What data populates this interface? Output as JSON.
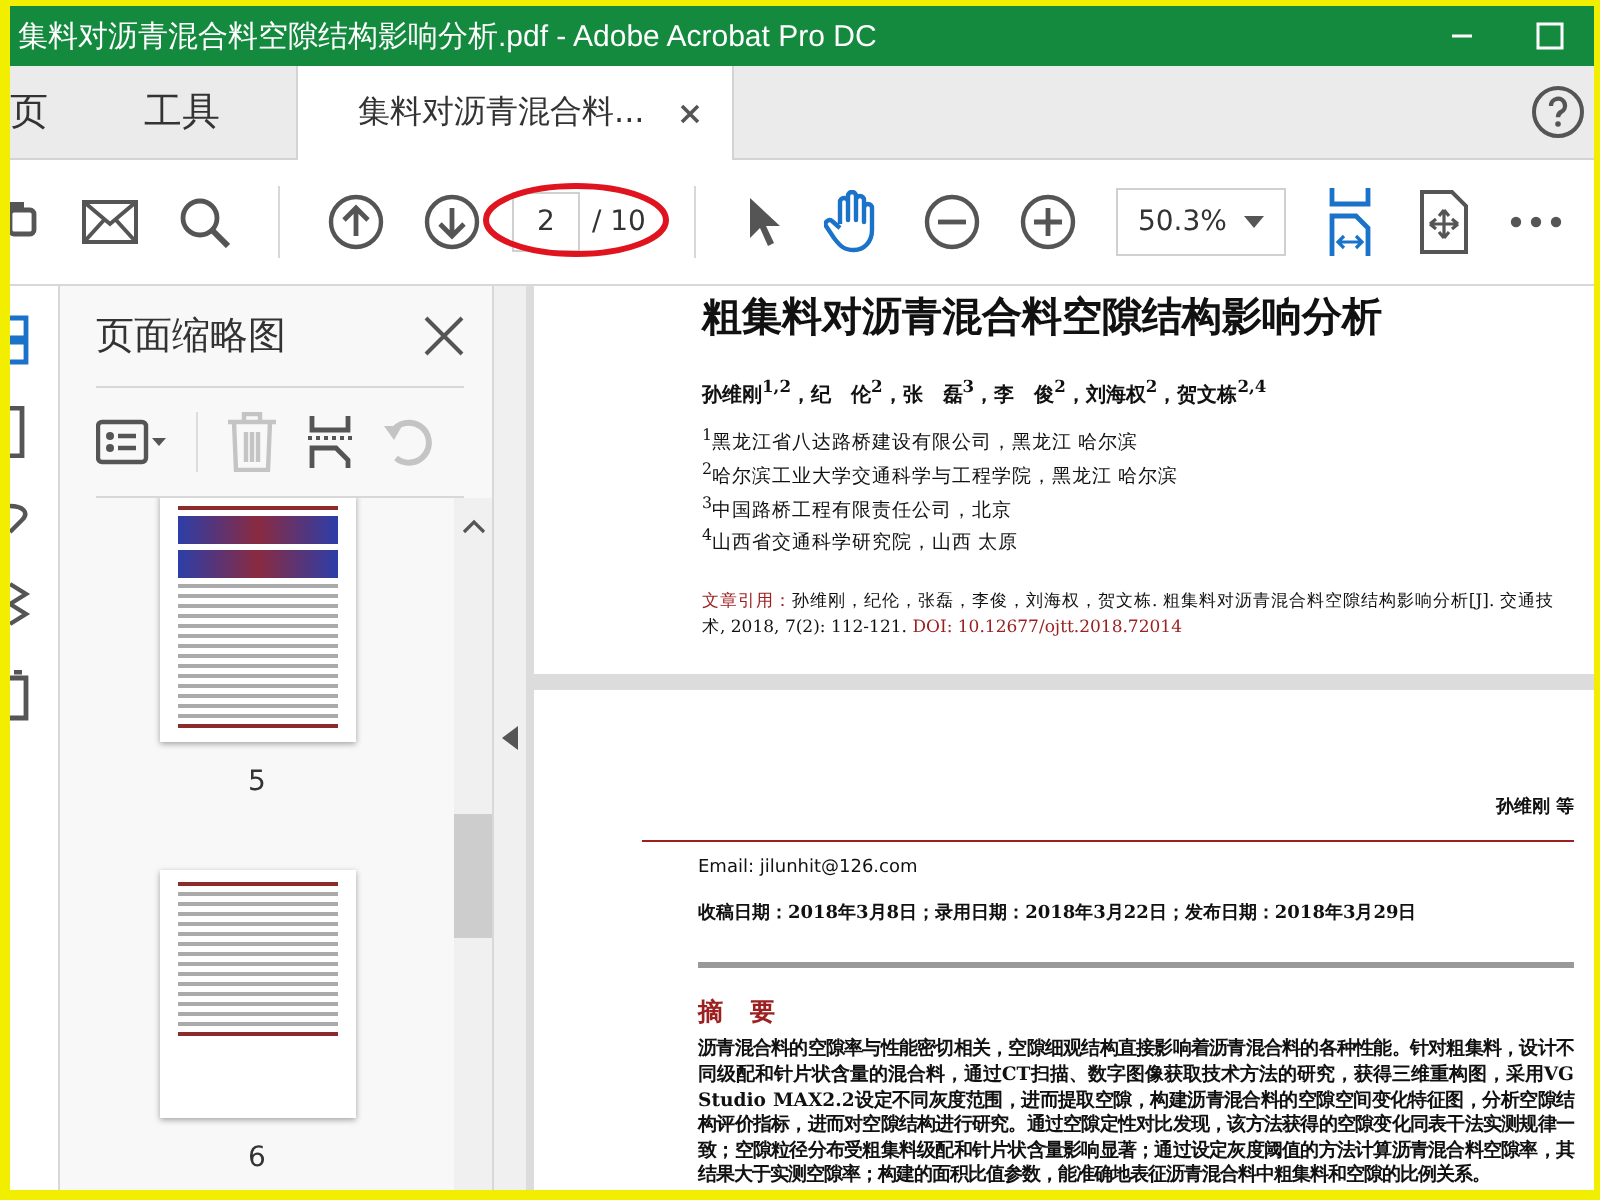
{
  "window": {
    "title": "集料对沥青混合料空隙结构影响分析.pdf - Adobe Acrobat Pro DC"
  },
  "tabs": [
    {
      "label": "页",
      "selected": false
    },
    {
      "label": "工具",
      "selected": false
    },
    {
      "label": "集料对沥青混合料...",
      "selected": true,
      "closable": true
    }
  ],
  "toolbar": {
    "page_number": "2",
    "page_total": "/ 10",
    "zoom": "50.3%",
    "hand_tool_active": true
  },
  "thumbnail_panel": {
    "title": "页面缩略图",
    "thumbnails": [
      {
        "label": "5"
      },
      {
        "label": "6"
      }
    ]
  },
  "document": {
    "page_1": {
      "title": "粗集料对沥青混合料空隙结构影响分析",
      "authors": "孙维刚$^{1,2}$，纪　伦$^{2}$，张　磊$^{3}$，李　俊$^{2}$，刘海权$^{2}$，贺文栋$^{2,4}$",
      "affiliations": [
        "$^{1}$黑龙江省八达路桥建设有限公司，黑龙江 哈尔滨",
        "$^{2}$哈尔滨工业大学交通科学与工程学院，黑龙江 哈尔滨",
        "$^{3}$中国路桥工程有限责任公司，北京",
        "$^{4}$山西省交通科学研究院，山西 太原"
      ],
      "citation_label": "文章引用：",
      "citation_text": "孙维刚，纪伦，张磊，李俊，刘海权，贺文栋. 粗集料对沥青混合料空隙结构影响分析[J]. 交通技术, 2018, 7(2): 112-121.",
      "doi": "DOI: 10.12677/ojtt.2018.72014"
    },
    "page_2": {
      "running_head": "孙维刚 等",
      "email": "Email: jilunhit@126.com",
      "dates": "收稿日期：2018年3月8日；录用日期：2018年3月22日；发布日期：2018年3月29日",
      "abstract_heading": "摘　要",
      "abstract": "沥青混合料的空隙率与性能密切相关，空隙细观结构直接影响着沥青混合料的各种性能。针对粗集料，设计不同级配和针片状含量的混合料，通过CT扫描、数字图像获取技术方法的研究，获得三维重构图，采用VG Studio MAX2.2设定不同灰度范围，进而提取空隙，构建沥青混合料的空隙空间变化特征图，分析空隙结构评价指标，进而对空隙结构进行研究。通过空隙定性对比发现，该方法获得的空隙变化同表干法实测规律一致；空隙粒径分布受粗集料级配和针片状含量影响显著；通过设定灰度阈值的方法计算沥青混合料空隙率，其结果大于实测空隙率；构建的面积比值参数，能准确地表征沥青混合料中粗集料和空隙的比例关系。"
    }
  }
}
